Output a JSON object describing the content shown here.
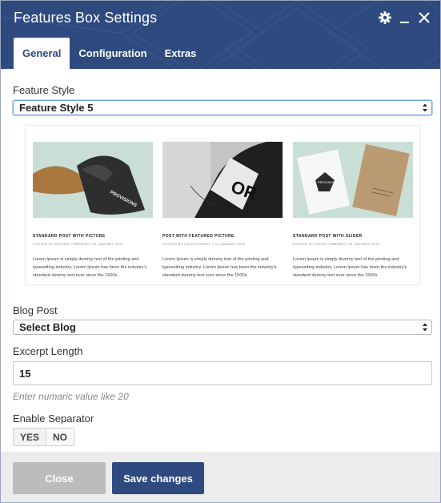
{
  "dialog": {
    "title": "Features Box Settings",
    "header_color": "#2e4a7f",
    "icons": [
      "gear-icon",
      "minimize-icon",
      "close-icon"
    ]
  },
  "tabs": [
    {
      "label": "General",
      "active": true
    },
    {
      "label": "Configuration",
      "active": false
    },
    {
      "label": "Extras",
      "active": false
    }
  ],
  "feature_style": {
    "label": "Feature Style",
    "value": "Feature Style 5"
  },
  "preview": {
    "posts": [
      {
        "title": "STANDARD POST WITH PICTURE",
        "meta": "POSTED BY MICHAEL FREEMON | 03 JANUARY 2016",
        "excerpt": "Lorem Ipsum is simply dummy text of the printing and typesetting industry. Lorem Ipsum has been the industry's standard dummy text ever since the 1500s.",
        "image_text": "PROVISIONS"
      },
      {
        "title": "POST WITH FEATURED PICTURE",
        "meta": "POSTED BY COLIN POWELL | 03 JANUARY 2016",
        "excerpt": "Lorem Ipsum is simply dummy text of the printing and typesetting industry. Lorem Ipsum has been the industry's standard dummy text ever since the 1500s.",
        "image_text": "OR"
      },
      {
        "title": "STANDARD POST WITH SLIDER",
        "meta": "POSTED BY VINCE LOMBARDI | 03 JANUARY 2016",
        "excerpt": "Lorem Ipsum is simply dummy text of the printing and typesetting industry. Lorem Ipsum has been the industry's standard dummy text ever since the 1500s.",
        "image_text": "PROVISIONS"
      }
    ]
  },
  "blog_post": {
    "label": "Blog Post",
    "value": "Select Blog"
  },
  "excerpt_length": {
    "label": "Excerpt Length",
    "value": "15",
    "hint": "Enter numaric value like 20"
  },
  "separator": {
    "label": "Enable Separator",
    "options": [
      "YES",
      "NO"
    ],
    "selected": "YES"
  },
  "footer": {
    "close_label": "Close",
    "save_label": "Save changes",
    "close_color": "#bcbcbc",
    "save_color": "#2e4a7f"
  }
}
